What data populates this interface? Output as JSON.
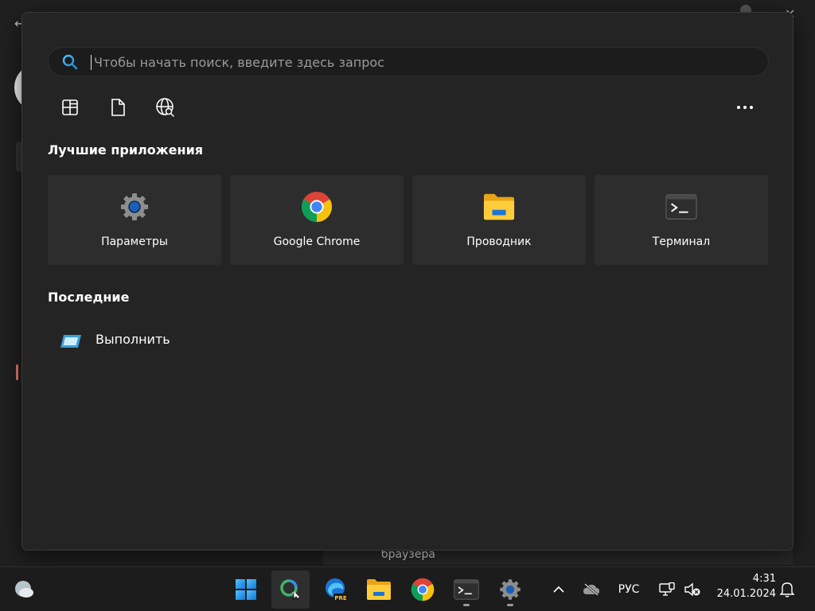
{
  "search": {
    "placeholder": "Чтобы начать поиск, введите здесь запрос"
  },
  "filters": [
    {
      "icon": "apps-icon"
    },
    {
      "icon": "document-icon"
    },
    {
      "icon": "web-search-icon"
    }
  ],
  "top_apps": {
    "title": "Лучшие приложения",
    "items": [
      {
        "label": "Параметры",
        "icon": "settings-gear-icon"
      },
      {
        "label": "Google Chrome",
        "icon": "chrome-icon"
      },
      {
        "label": "Проводник",
        "icon": "file-explorer-icon"
      },
      {
        "label": "Терминал",
        "icon": "terminal-icon"
      }
    ]
  },
  "recent": {
    "title": "Последние",
    "items": [
      {
        "label": "Выполнить",
        "icon": "run-dialog-icon"
      }
    ]
  },
  "background": {
    "tooltip": "браузера"
  },
  "taskbar": {
    "language": "РУС",
    "time": "4:31",
    "date": "24.01.2024",
    "edge_badge": "PRE"
  },
  "colors": {
    "accent": "#0067c0",
    "flyout_bg": "#242424",
    "tile_bg": "#2d2d2d",
    "taskbar_bg": "#1c1c1c"
  }
}
